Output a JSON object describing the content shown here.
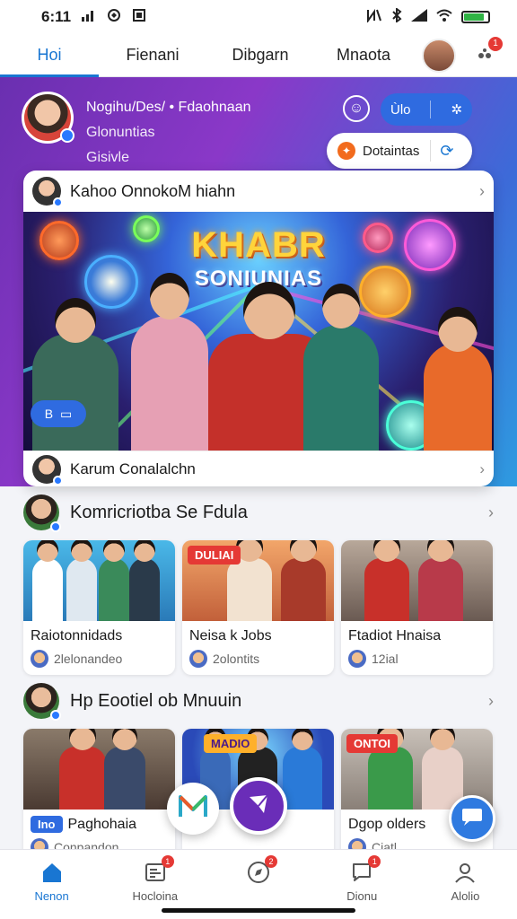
{
  "status_bar": {
    "time": "6:11",
    "left_icons": [
      "signal-bars-icon",
      "app-icon",
      "image-icon"
    ],
    "right_icons": [
      "nfc-icon",
      "bluetooth-icon",
      "signal-icon",
      "wifi-icon",
      "battery-icon"
    ],
    "battery_level": 0.85
  },
  "top_tabs": [
    {
      "label": "Hoi",
      "active": true
    },
    {
      "label": "Fienani",
      "active": false
    },
    {
      "label": "Dibgarn",
      "active": false
    },
    {
      "label": "Mnaota",
      "active": false
    }
  ],
  "top_notification_badge": "1",
  "profile": {
    "line1": "Nogihu/Des/ • Fdaohnaan",
    "line2": "Glonuntias",
    "line3": "Gisivle"
  },
  "hero_pill": {
    "left": "Ùlo",
    "right": "✲"
  },
  "donate_button": {
    "label": "Dotaintas"
  },
  "feature_card": {
    "header": "Kahoo OnnokoM hiahn",
    "image_title_line1": "KHABR",
    "image_title_line2": "SONIUNIAS",
    "badge": "B",
    "footer": "Karum Conalalchn"
  },
  "section1": {
    "title": "Komricriotba Se Fdula",
    "cards": [
      {
        "title": "Raiotonnidads",
        "meta": "2lelonandeo",
        "tag": ""
      },
      {
        "title": "Neisa k Jobs",
        "meta": "2olontits",
        "tag": "DULIAI"
      },
      {
        "title": "Ftadiot Hnaisa",
        "meta": "12ial",
        "tag": ""
      }
    ]
  },
  "section2": {
    "title": "Hp Eootiel ob Mnuuin",
    "cards": [
      {
        "title": "Paghohaia",
        "meta": "Conpandon",
        "tag": "Ino"
      },
      {
        "title": "",
        "meta": "",
        "tag": "MADIO"
      },
      {
        "title": "Dgop olders",
        "meta": "Ciatl",
        "tag": "ONTOI"
      }
    ]
  },
  "bottom_nav": [
    {
      "label": "Nenon",
      "icon": "home-icon",
      "active": true,
      "badge": ""
    },
    {
      "label": "Hocloina",
      "icon": "news-icon",
      "active": false,
      "badge": "1"
    },
    {
      "label": "",
      "icon": "compass-icon",
      "active": false,
      "badge": "2"
    },
    {
      "label": "Dionu",
      "icon": "chat-icon",
      "active": false,
      "badge": "1"
    },
    {
      "label": "Alolio",
      "icon": "profile-icon",
      "active": false,
      "badge": ""
    }
  ],
  "colors": {
    "accent": "#1976d2",
    "hero_start": "#6a2fb0",
    "hero_end": "#2e9be0",
    "badge_red": "#e53935",
    "fab_purple": "#6a2db8"
  }
}
